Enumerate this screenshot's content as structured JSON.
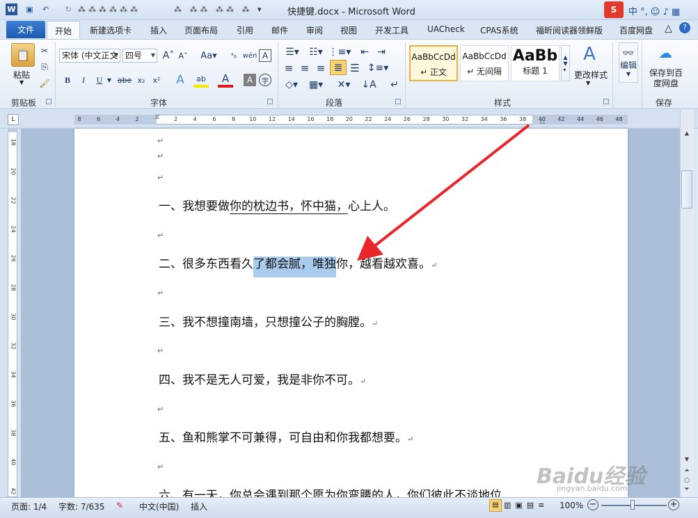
{
  "window": {
    "title": "快捷键.docx  -  Microsoft Word"
  },
  "tabs": {
    "file": "文件",
    "items": [
      "开始",
      "新建选项卡",
      "插入",
      "页面布局",
      "引用",
      "邮件",
      "审阅",
      "视图",
      "开发工具",
      "UACheck",
      "CPAS系统",
      "福昕阅读器领鲜版",
      "百度网盘"
    ]
  },
  "ribbon": {
    "clipboard": {
      "paste": "粘贴",
      "group": "剪贴板"
    },
    "font": {
      "name": "宋体 (中文正文",
      "size": "四号",
      "group": "字体",
      "bold": "B",
      "italic": "I",
      "underline": "U",
      "strike": "abe",
      "subscript": "x₂",
      "superscript": "x²",
      "grow": "A",
      "shrink": "A",
      "case": "Aa",
      "wen": "wén",
      "a_box": "A",
      "char": "字"
    },
    "paragraph": {
      "group": "段落"
    },
    "styles": {
      "group": "样式",
      "items": [
        {
          "sample": "AaBbCcDd",
          "name": "↵ 正文"
        },
        {
          "sample": "AaBbCcDd",
          "name": "↵ 无间隔"
        },
        {
          "sample": "AaBb",
          "name": "标题 1"
        }
      ],
      "change": "更改样式"
    },
    "editing": {
      "label": "编辑"
    },
    "save": {
      "label": "保存到百度网盘",
      "group": "保存"
    }
  },
  "ruler": {
    "ticks": [
      "8",
      "6",
      "4",
      "2",
      "",
      "2",
      "4",
      "6",
      "8",
      "10",
      "12",
      "14",
      "16",
      "18",
      "20",
      "22",
      "24",
      "26",
      "28",
      "30",
      "32",
      "34",
      "36",
      "38",
      "40",
      "42",
      "44",
      "46",
      "48"
    ],
    "vticks": [
      "18",
      "20",
      "22",
      "24",
      "26",
      "28",
      "30",
      "32",
      "34",
      "36",
      "38",
      "40",
      "42",
      "44"
    ]
  },
  "document": {
    "paragraphs": {
      "p1": {
        "before": "一、我想要做",
        "ul": "你的枕边书，怀中猫，",
        "after": "心上人。"
      },
      "p2": {
        "before": "二、很多东西看久",
        "sel": "了都会腻，唯独",
        "after": "你，越看越欢喜。"
      },
      "p3": "三、我不想撞南墙，只想撞公子的胸膛。",
      "p4": "四、我不是无人可爱，我是非你不可。",
      "p5": "五、鱼和熊掌不可兼得，可自由和你我都想要。",
      "p6": "六、有一天，你总会遇到那个愿为你弯腰的人，你们彼此不谈地位"
    },
    "para_mark": "↵"
  },
  "status": {
    "page": "页面: 1/4",
    "words": "字数: 7/635",
    "language": "中文(中国)",
    "insert": "插入",
    "zoom": "100%"
  },
  "watermark": "Baidu经验",
  "watermark_sub": "jingyan.baidu.com",
  "colors": {
    "accent": "#2b579a",
    "selection": "#a9cbee",
    "arrow": "#e8262b"
  }
}
